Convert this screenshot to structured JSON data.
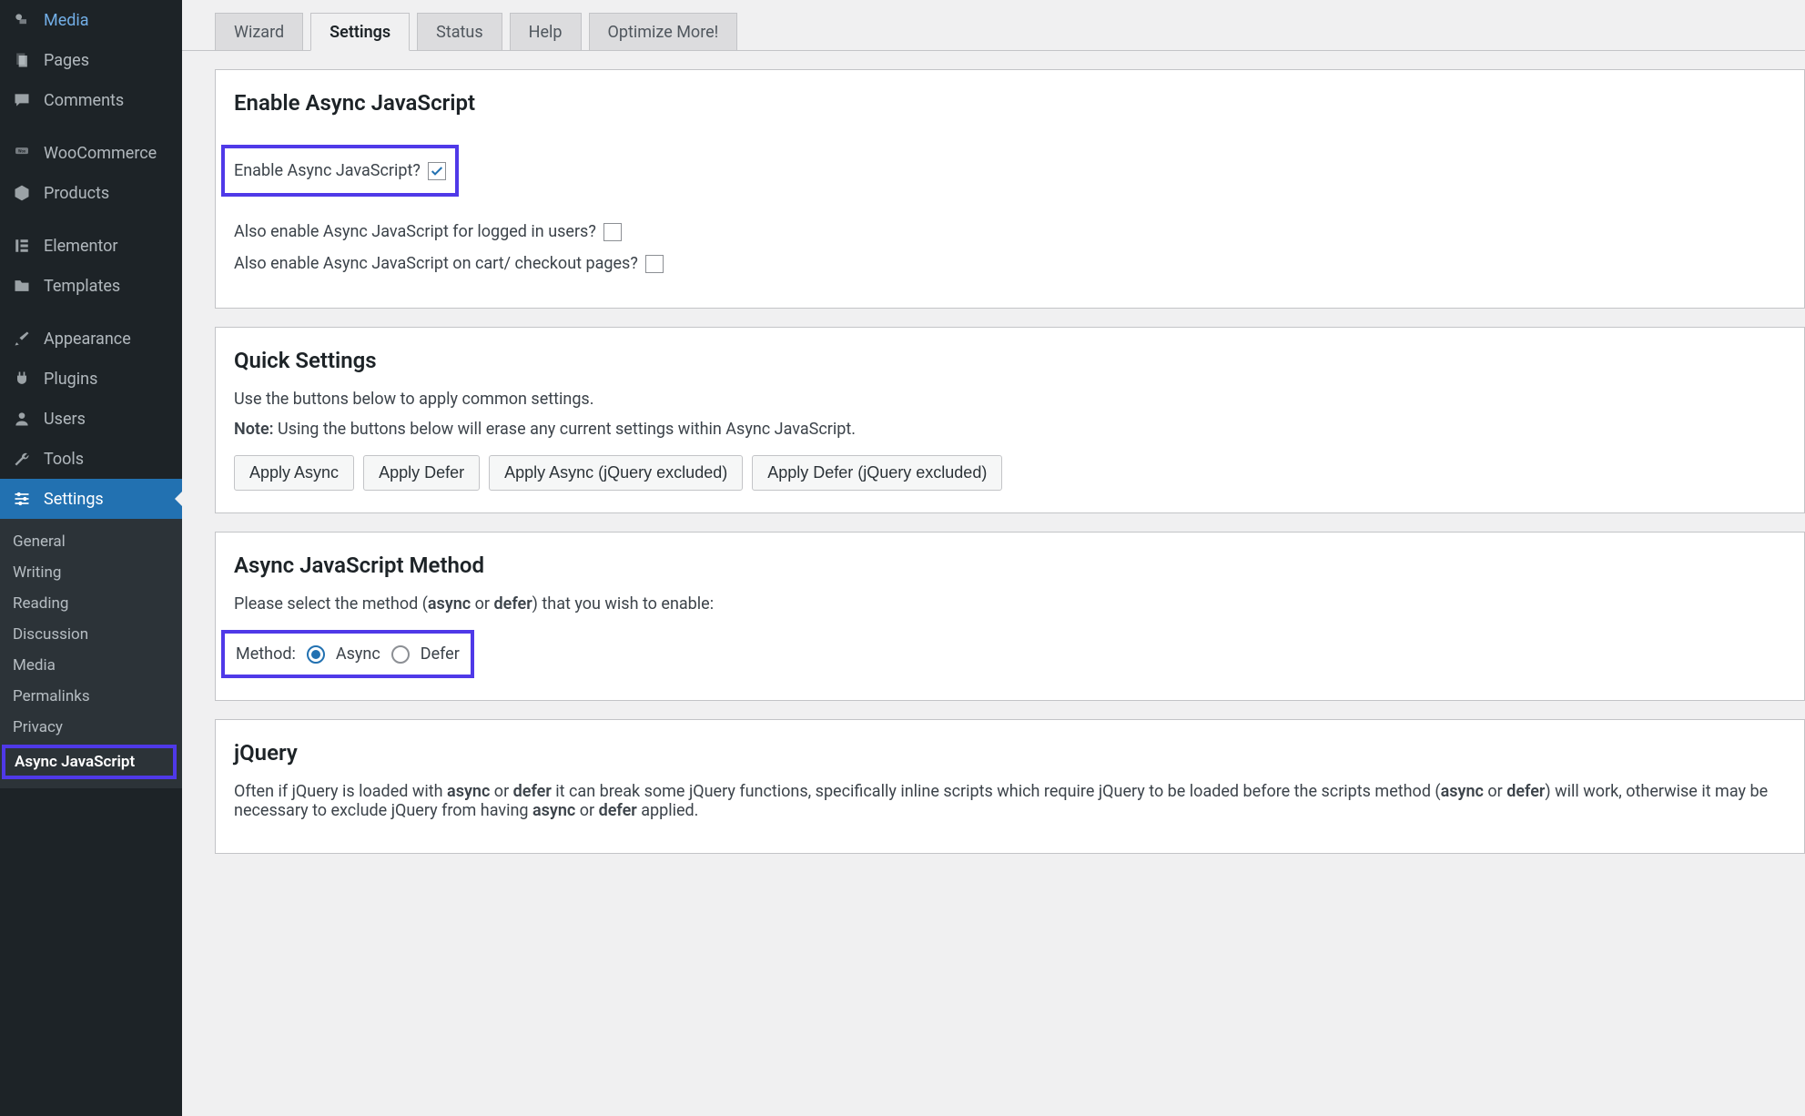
{
  "sidebar": {
    "items": [
      {
        "label": "Media",
        "icon": "media"
      },
      {
        "label": "Pages",
        "icon": "page"
      },
      {
        "label": "Comments",
        "icon": "comment"
      },
      {
        "label": "WooCommerce",
        "icon": "woo"
      },
      {
        "label": "Products",
        "icon": "box"
      },
      {
        "label": "Elementor",
        "icon": "elementor"
      },
      {
        "label": "Templates",
        "icon": "folder"
      },
      {
        "label": "Appearance",
        "icon": "brush"
      },
      {
        "label": "Plugins",
        "icon": "plug"
      },
      {
        "label": "Users",
        "icon": "user"
      },
      {
        "label": "Tools",
        "icon": "wrench"
      },
      {
        "label": "Settings",
        "icon": "sliders",
        "active": true
      }
    ],
    "sub": [
      {
        "label": "General"
      },
      {
        "label": "Writing"
      },
      {
        "label": "Reading"
      },
      {
        "label": "Discussion"
      },
      {
        "label": "Media"
      },
      {
        "label": "Permalinks"
      },
      {
        "label": "Privacy"
      },
      {
        "label": "Async JavaScript",
        "highlight": true
      }
    ]
  },
  "tabs": [
    {
      "label": "Wizard"
    },
    {
      "label": "Settings",
      "active": true
    },
    {
      "label": "Status"
    },
    {
      "label": "Help"
    },
    {
      "label": "Optimize More!"
    }
  ],
  "enable_section": {
    "heading": "Enable Async JavaScript",
    "enable_label": "Enable Async JavaScript?",
    "enable_checked": true,
    "logged_in_label": "Also enable Async JavaScript for logged in users?",
    "logged_in_checked": false,
    "cart_label": "Also enable Async JavaScript on cart/ checkout pages?",
    "cart_checked": false
  },
  "quick": {
    "heading": "Quick Settings",
    "intro": "Use the buttons below to apply common settings.",
    "note_prefix": "Note:",
    "note_body": " Using the buttons below will erase any current settings within Async JavaScript.",
    "buttons": [
      "Apply Async",
      "Apply Defer",
      "Apply Async (jQuery excluded)",
      "Apply Defer (jQuery excluded)"
    ]
  },
  "method": {
    "heading": "Async JavaScript Method",
    "intro_pre": "Please select the method (",
    "intro_b1": "async",
    "intro_mid": " or ",
    "intro_b2": "defer",
    "intro_post": ") that you wish to enable:",
    "label": "Method:",
    "option_async": "Async",
    "option_defer": "Defer",
    "selected": "async"
  },
  "jquery": {
    "heading": "jQuery",
    "p_pre": "Often if jQuery is loaded with ",
    "p_b1": "async",
    "p_mid1": " or ",
    "p_b2": "defer",
    "p_mid2": " it can break some jQuery functions, specifically inline scripts which require jQuery to be loaded before the scripts method (",
    "p_b3": "async",
    "p_mid3": " or ",
    "p_b4": "defer",
    "p_mid4": ") will work, otherwise it may be necessary to exclude jQuery from having ",
    "p_b5": "async",
    "p_mid5": " or ",
    "p_b6": "defer",
    "p_post": " applied."
  }
}
